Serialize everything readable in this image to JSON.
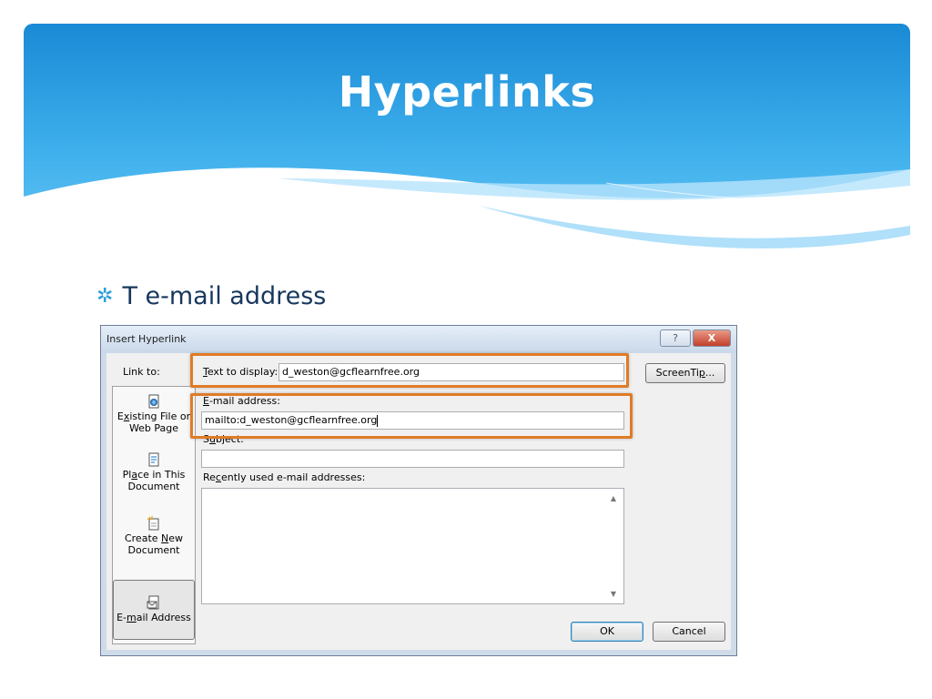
{
  "slide": {
    "title": "Hyperlinks",
    "bullet": "T e-mail address"
  },
  "colors": {
    "banner_top": "#1e8fd9",
    "banner_bottom": "#5ec3f4",
    "title_text": "#ffffff",
    "bullet_text": "#17375e",
    "highlight": "#e07b26"
  },
  "dialog": {
    "title": "Insert Hyperlink",
    "help_label": "?",
    "close_label": "X",
    "link_to_label": "Link to:",
    "link_to_items": [
      {
        "icon": "existing-file-icon",
        "line1_pre": "E",
        "line1_u": "x",
        "line1_post": "isting File or",
        "line2": "Web Page"
      },
      {
        "icon": "place-in-document-icon",
        "line1_pre": "Pl",
        "line1_u": "a",
        "line1_post": "ce in This",
        "line2": "Document"
      },
      {
        "icon": "create-new-document-icon",
        "line1_pre": "Create ",
        "line1_u": "N",
        "line1_post": "ew",
        "line2": "Document"
      },
      {
        "icon": "email-address-icon",
        "line1_pre": "E-",
        "line1_u": "m",
        "line1_post": "ail Address",
        "line2": ""
      }
    ],
    "text_to_display": {
      "label_u": "T",
      "label_rest": "ext to display:",
      "value": "d_weston@gcflearnfree.org"
    },
    "screentip_pre": "ScreenTi",
    "screentip_u": "p",
    "screentip_post": "...",
    "email": {
      "label_u": "E",
      "label_rest": "-mail address:",
      "value": "mailto:d_weston@gcflearnfree.org"
    },
    "subject": {
      "label_pre": "S",
      "label_u": "u",
      "label_rest": "bject:",
      "value": ""
    },
    "recent": {
      "label_pre": "Re",
      "label_u": "c",
      "label_rest": "ently used e-mail addresses:"
    },
    "ok_label": "OK",
    "cancel_label": "Cancel"
  }
}
